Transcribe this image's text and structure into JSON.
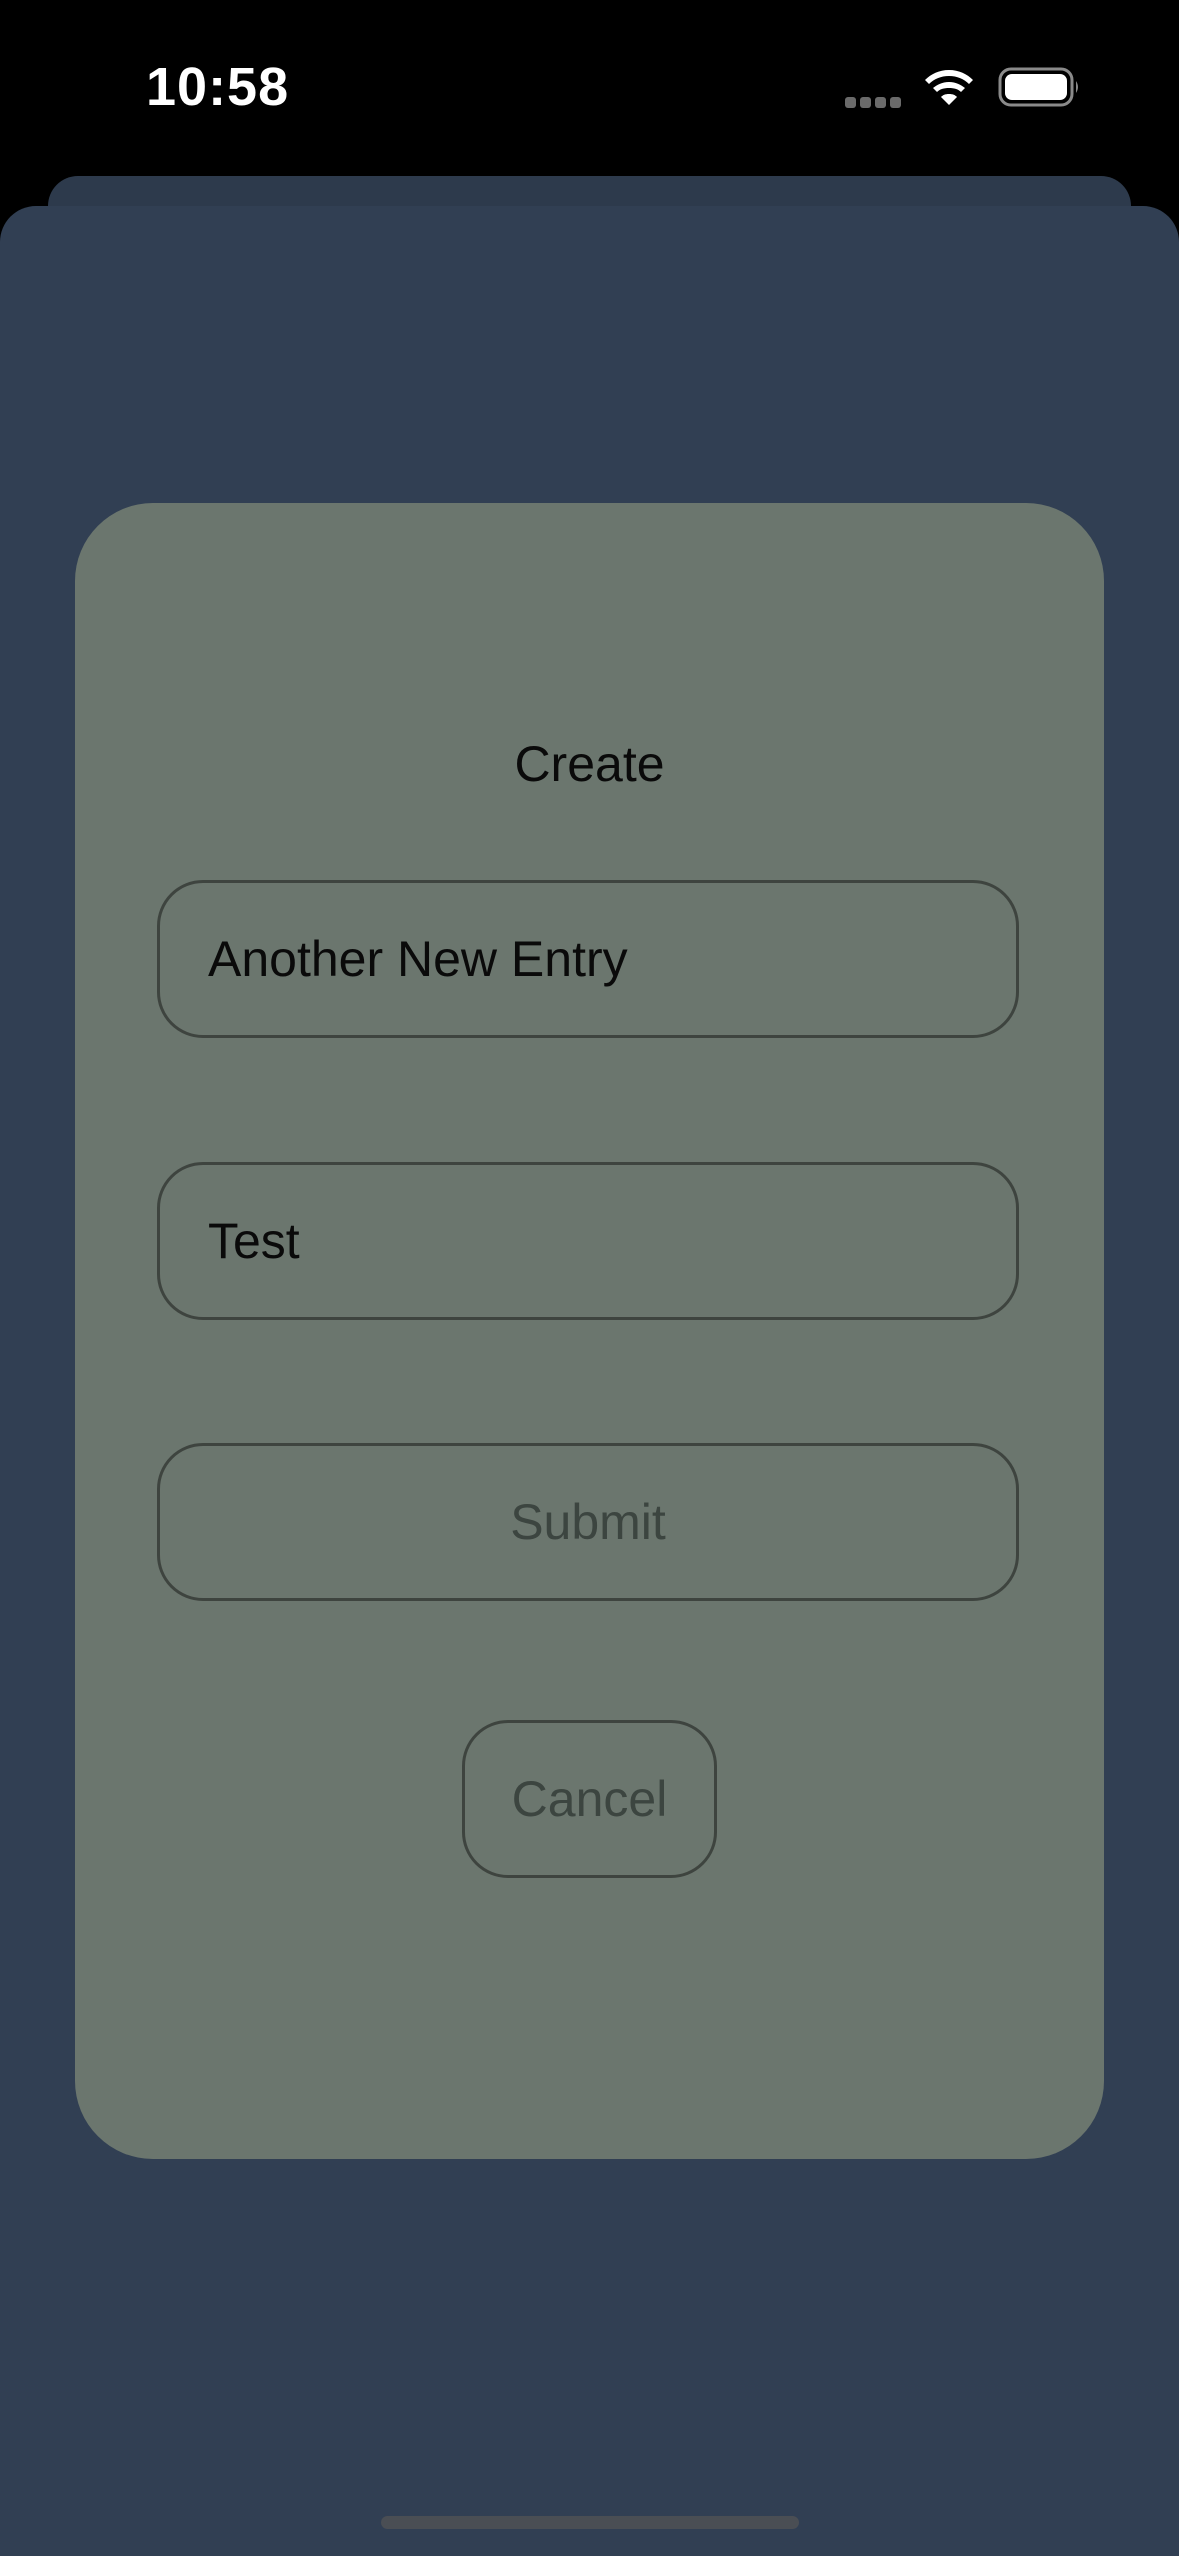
{
  "status_bar": {
    "time": "10:58",
    "icons": [
      "cellular-signal-icon",
      "wifi-icon",
      "battery-icon"
    ]
  },
  "dialog": {
    "title": "Create",
    "title_field": {
      "value": "Another New Entry",
      "placeholder": ""
    },
    "body_field": {
      "value": "Test",
      "placeholder": ""
    },
    "submit_label": "Submit",
    "cancel_label": "Cancel"
  },
  "colors": {
    "background": "#313f53",
    "dialog": "#6b766e",
    "border": "#3e443f",
    "button_text": "#3c4540"
  }
}
